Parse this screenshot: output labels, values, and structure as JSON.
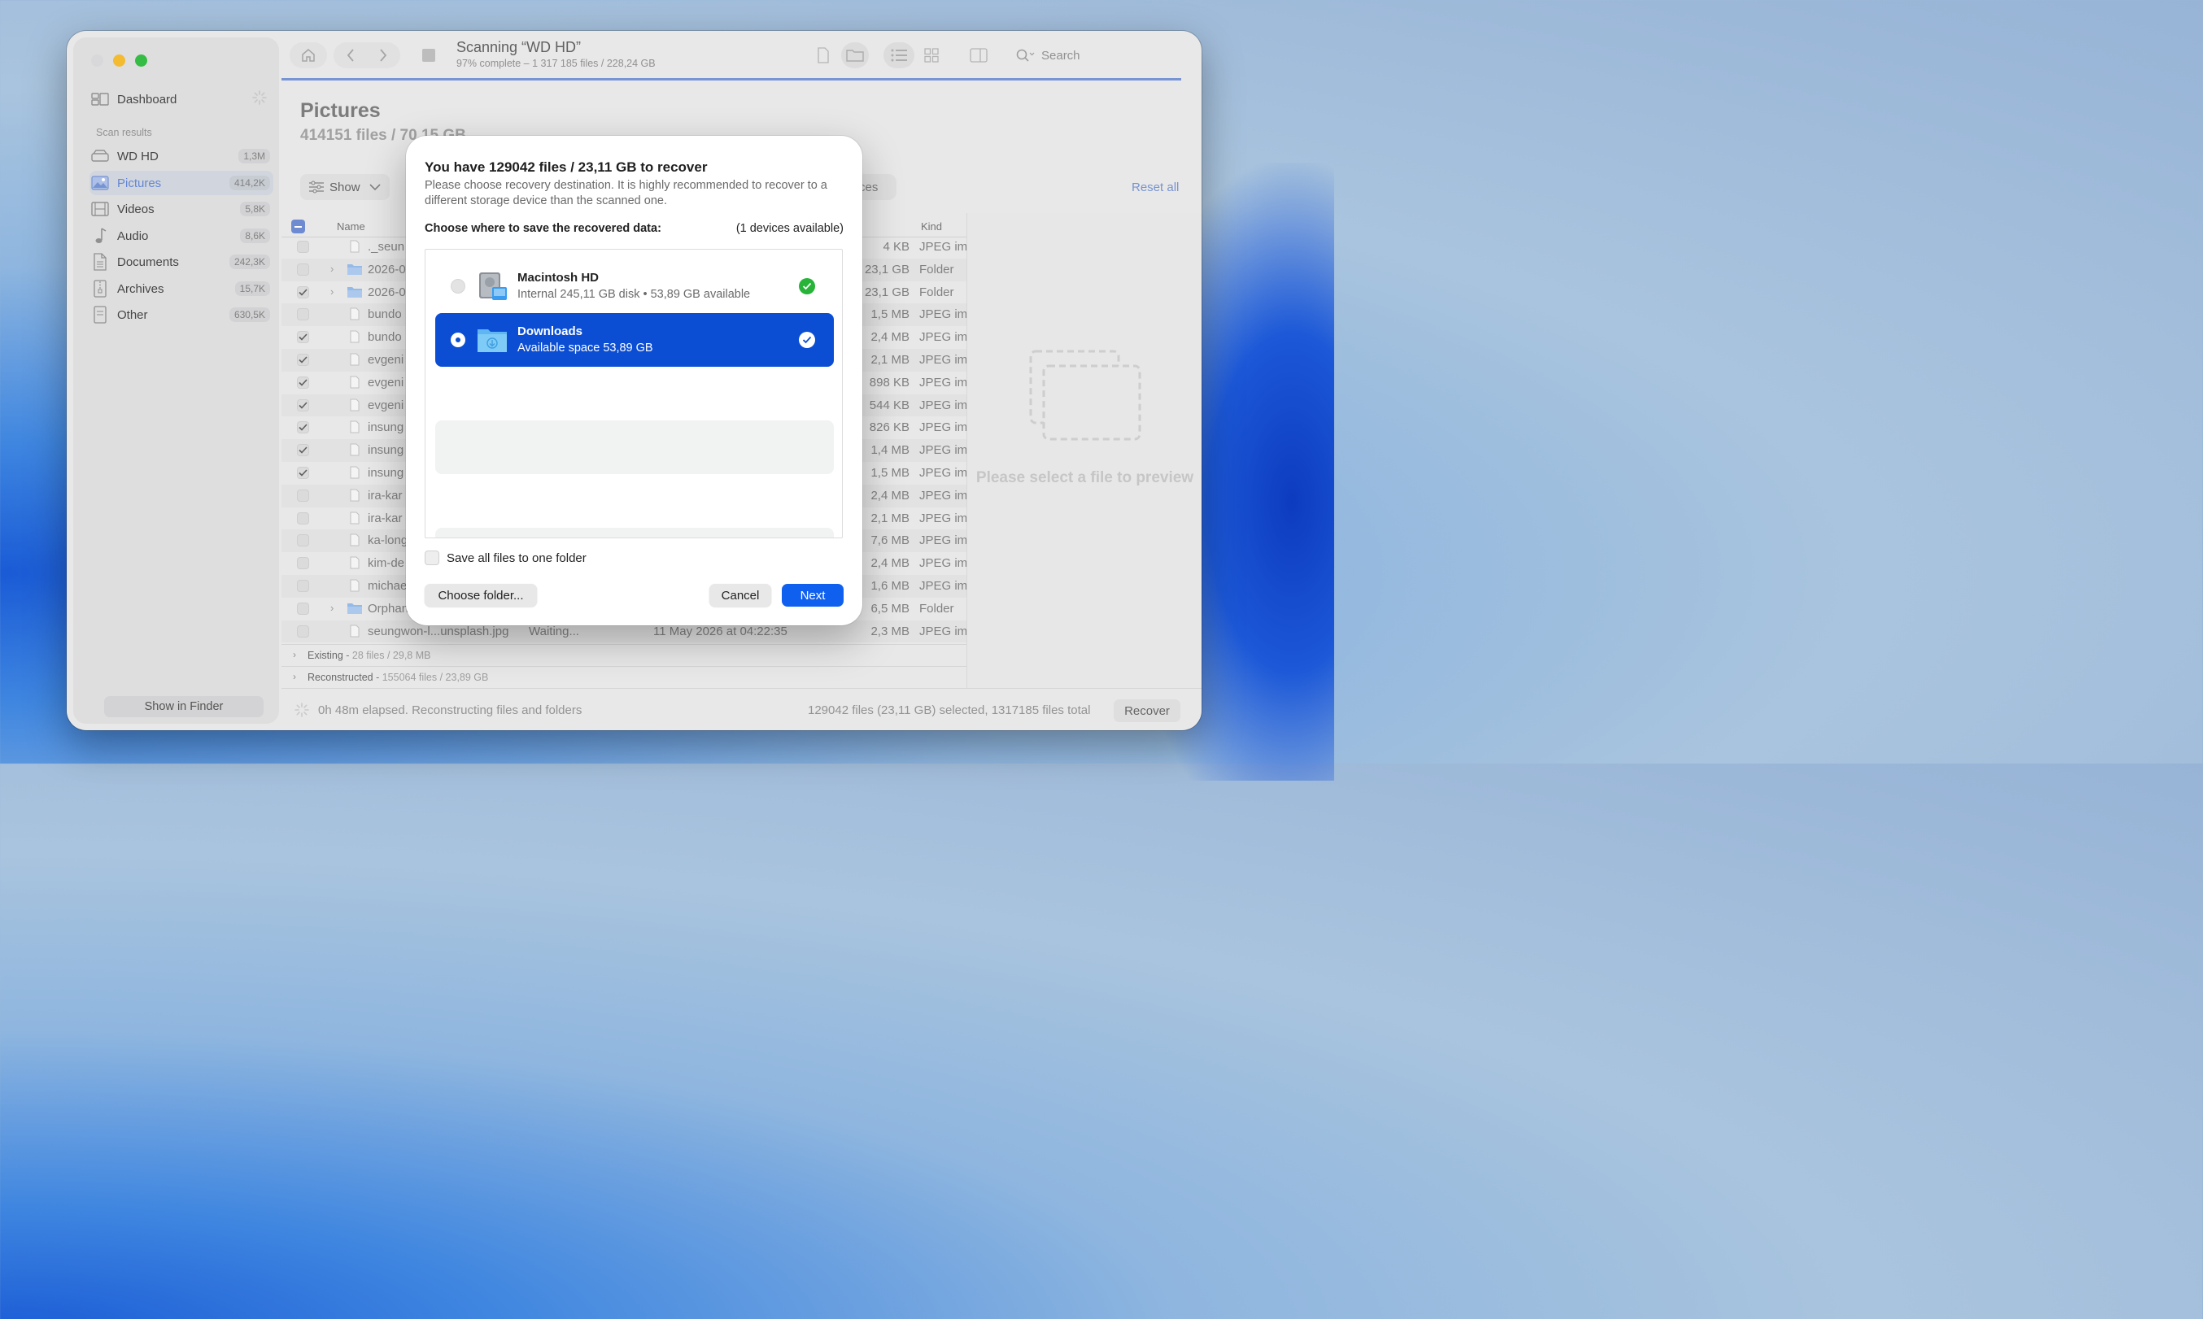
{
  "window": {
    "title": "Scanning “WD HD”",
    "subtitle": "97% complete – 1 317 185 files / 228,24 GB",
    "search_placeholder": "Search"
  },
  "sidebar": {
    "dashboard": "Dashboard",
    "section": "Scan results",
    "items": [
      {
        "label": "WD HD",
        "count": "1,3M",
        "icon": "drive-icon"
      },
      {
        "label": "Pictures",
        "count": "414,2K",
        "icon": "picture-icon"
      },
      {
        "label": "Videos",
        "count": "5,8K",
        "icon": "film-icon"
      },
      {
        "label": "Audio",
        "count": "8,6K",
        "icon": "music-note-icon"
      },
      {
        "label": "Documents",
        "count": "242,3K",
        "icon": "document-icon"
      },
      {
        "label": "Archives",
        "count": "15,7K",
        "icon": "archive-icon"
      },
      {
        "label": "Other",
        "count": "630,5K",
        "icon": "other-file-icon"
      }
    ],
    "show_in_finder": "Show in Finder"
  },
  "content": {
    "title": "Pictures",
    "subtitle": "414151 files / 70,15 GB",
    "show_label": "Show",
    "filter_pill": "ces",
    "reset_all": "Reset all",
    "col_name": "Name",
    "col_kind": "Kind"
  },
  "rows": [
    {
      "name": "._seun",
      "size": "4 KB",
      "kind": "JPEG im",
      "checked": false,
      "folder": false,
      "status": "",
      "date": ""
    },
    {
      "name": "2026-0",
      "size": "23,1 GB",
      "kind": "Folder",
      "checked": false,
      "folder": true,
      "status": "",
      "date": ""
    },
    {
      "name": "2026-0",
      "size": "23,1 GB",
      "kind": "Folder",
      "checked": true,
      "folder": true,
      "status": "",
      "date": ""
    },
    {
      "name": "bundo",
      "size": "1,5 MB",
      "kind": "JPEG im",
      "checked": false,
      "folder": false,
      "status": "",
      "date": ""
    },
    {
      "name": "bundo",
      "size": "2,4 MB",
      "kind": "JPEG im",
      "checked": true,
      "folder": false,
      "status": "",
      "date": ""
    },
    {
      "name": "evgeni",
      "size": "2,1 MB",
      "kind": "JPEG im",
      "checked": true,
      "folder": false,
      "status": "",
      "date": ""
    },
    {
      "name": "evgeni",
      "size": "898 KB",
      "kind": "JPEG im",
      "checked": true,
      "folder": false,
      "status": "",
      "date": ""
    },
    {
      "name": "evgeni",
      "size": "544 KB",
      "kind": "JPEG im",
      "checked": true,
      "folder": false,
      "status": "",
      "date": ""
    },
    {
      "name": "insung",
      "size": "826 KB",
      "kind": "JPEG im",
      "checked": true,
      "folder": false,
      "status": "",
      "date": ""
    },
    {
      "name": "insung",
      "size": "1,4 MB",
      "kind": "JPEG im",
      "checked": true,
      "folder": false,
      "status": "",
      "date": ""
    },
    {
      "name": "insung",
      "size": "1,5 MB",
      "kind": "JPEG im",
      "checked": true,
      "folder": false,
      "status": "",
      "date": ""
    },
    {
      "name": "ira-kar",
      "size": "2,4 MB",
      "kind": "JPEG im",
      "checked": false,
      "folder": false,
      "status": "",
      "date": ""
    },
    {
      "name": "ira-kar",
      "size": "2,1 MB",
      "kind": "JPEG im",
      "checked": false,
      "folder": false,
      "status": "",
      "date": ""
    },
    {
      "name": "ka-long",
      "size": "7,6 MB",
      "kind": "JPEG im",
      "checked": false,
      "folder": false,
      "status": "",
      "date": ""
    },
    {
      "name": "kim-de",
      "size": "2,4 MB",
      "kind": "JPEG im",
      "checked": false,
      "folder": false,
      "status": "",
      "date": ""
    },
    {
      "name": "michae",
      "size": "1,6 MB",
      "kind": "JPEG im",
      "checked": false,
      "folder": false,
      "status": "",
      "date": ""
    },
    {
      "name": "Orphan",
      "size": "6,5 MB",
      "kind": "Folder",
      "checked": false,
      "folder": true,
      "status": "",
      "date": ""
    },
    {
      "name": "seungwon-l...unsplash.jpg",
      "size": "2,3 MB",
      "kind": "JPEG im",
      "checked": false,
      "folder": false,
      "status": "Waiting...",
      "date": "11 May 2026 at 04:22:35"
    }
  ],
  "groups": [
    {
      "name": "Existing",
      "detail": "28 files / 29,8 MB"
    },
    {
      "name": "Reconstructed",
      "detail": "155064 files / 23,89 GB"
    }
  ],
  "preview_text": "Please select a file to preview",
  "status": {
    "elapsed": "0h 48m elapsed. Reconstructing files and folders",
    "selection": "129042 files (23,11 GB) selected, 1317185 files total",
    "recover": "Recover"
  },
  "modal": {
    "title": "You have 129042 files / 23,11 GB to recover",
    "description": "Please choose recovery destination. It is highly recommended to recover to a different storage device than the scanned one.",
    "choose_label": "Choose where to save the recovered data:",
    "devices_available": "(1 devices available)",
    "devices": [
      {
        "name": "Macintosh HD",
        "detail": "Internal 245,11 GB disk • 53,89 GB available",
        "selected": false
      },
      {
        "name": "Downloads",
        "detail": "Available space 53,89 GB",
        "selected": true
      }
    ],
    "save_one_folder": "Save all files to one folder",
    "choose_folder": "Choose folder...",
    "cancel": "Cancel",
    "next": "Next"
  },
  "colors": {
    "accent": "#1060f0",
    "selected_row": "#0b4ed4",
    "ok_green": "#27b438"
  }
}
